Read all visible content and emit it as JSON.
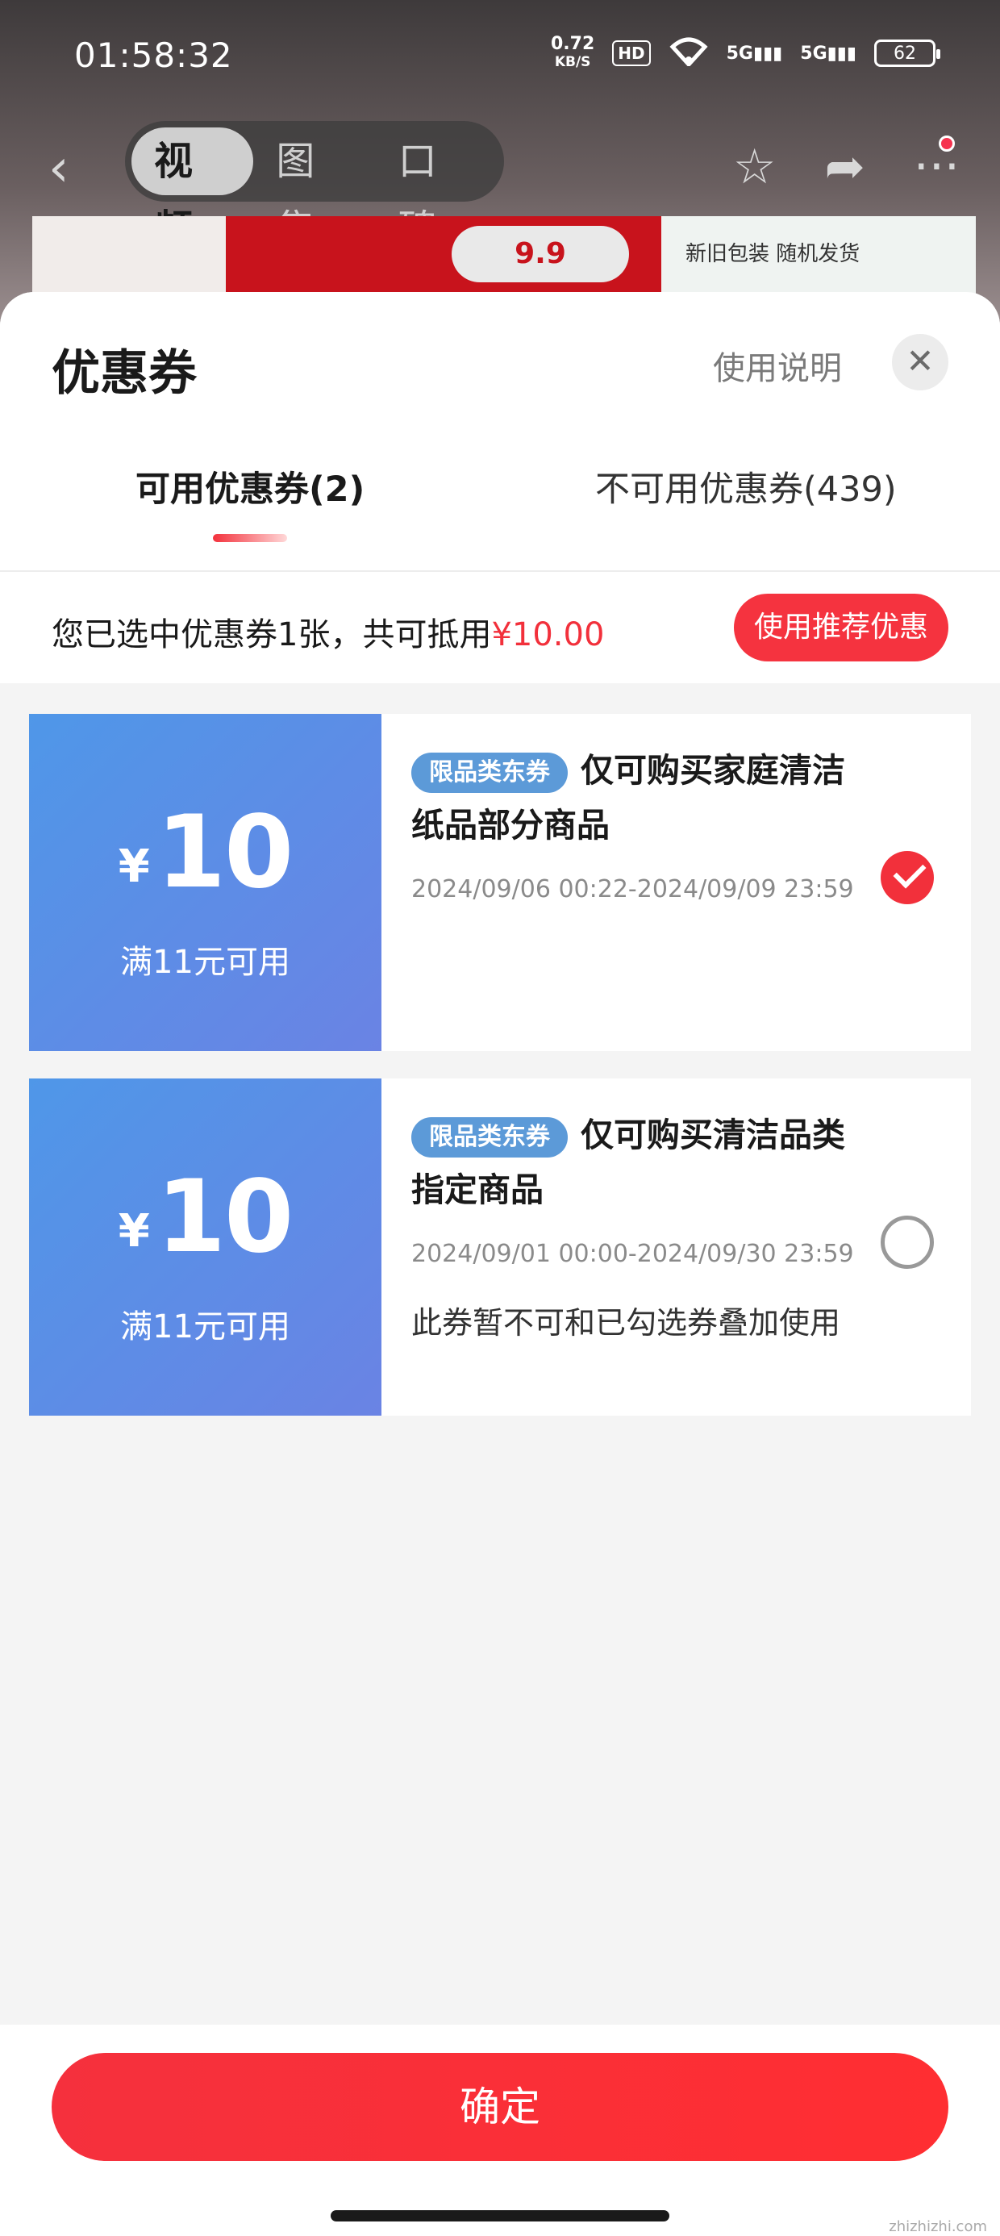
{
  "status_bar": {
    "time": "01:58:32",
    "net_speed": "0.72",
    "net_unit": "KB/S",
    "hd_badge": "HD",
    "sim1": "5G",
    "sim2": "5G",
    "battery": "62"
  },
  "nav": {
    "tabs": [
      "视频",
      "图集",
      "口碑"
    ],
    "active_tab": "视频"
  },
  "banner": {
    "logo_text": "9.9",
    "right_text": "新旧包装 随机发货"
  },
  "sheet": {
    "title": "优惠券",
    "help_label": "使用说明",
    "close_label": "✕",
    "tabs": {
      "available": "可用优惠券(2)",
      "unavailable": "不可用优惠券(439)"
    },
    "summary": {
      "prefix": "您已选中优惠券1张，共可抵用",
      "amount": "¥10.00"
    },
    "recommend_label": "使用推荐优惠"
  },
  "coupons": [
    {
      "currency": "¥",
      "amount": "10",
      "condition": "满11元可用",
      "tag": "限品类东券",
      "title_line1": "仅可购买家庭清洁",
      "title_line2": "纸品部分商品",
      "date_range": "2024/09/06 00:22-2024/09/09 23:59",
      "selected": true,
      "note": ""
    },
    {
      "currency": "¥",
      "amount": "10",
      "condition": "满11元可用",
      "tag": "限品类东券",
      "title_line1": "仅可购买清洁品类",
      "title_line2": "指定商品",
      "date_range": "2024/09/01 00:00-2024/09/30 23:59",
      "selected": false,
      "note": "此券暂不可和已勾选券叠加使用"
    }
  ],
  "footer": {
    "confirm_label": "确定",
    "watermark": "zhizhizhi.com"
  },
  "colors": {
    "accent_red": "#f2303b",
    "coupon_blue_start": "#4f97e8",
    "coupon_blue_end": "#6a83e4",
    "tag_blue": "#5c9ad8"
  }
}
